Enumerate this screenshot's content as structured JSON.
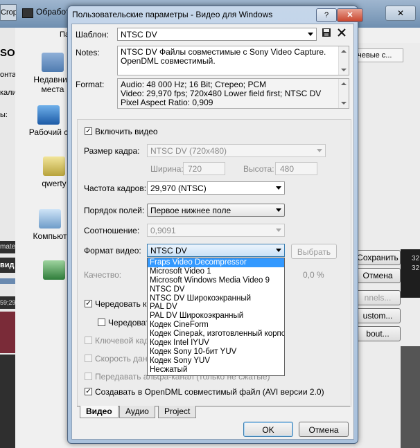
{
  "background_app": {
    "tab_fragment": "Crop",
    "title_fragment": "Обработ",
    "close_symbol": "✕",
    "left_strip": [
      "Па",
      "SOC",
      "онта",
      "кали",
      "ы:",
      "mate",
      " вид",
      "59;29"
    ],
    "right_column_header": "чевые с...",
    "right_buttons": [
      {
        "label": "Сохранить"
      },
      {
        "label": "Отмена"
      },
      {
        "label": "nnels..."
      },
      {
        "label": "ustom..."
      },
      {
        "label": "bout..."
      }
    ],
    "right_dark_text": [
      "32;",
      "32:"
    ]
  },
  "desktop_icons": [
    {
      "label": "Недавние места",
      "icon": "recent-places-icon"
    },
    {
      "label": "Рабочий с",
      "icon": "desktop-icon"
    },
    {
      "label": "qwerty",
      "icon": "user-folder-icon"
    },
    {
      "label": "Компьют",
      "icon": "computer-icon"
    },
    {
      "label": "",
      "icon": "network-icon"
    }
  ],
  "dialog": {
    "title": "Пользовательские параметры - Видео для Windows",
    "help_symbol": "?",
    "close_symbol": "✕",
    "template": {
      "label": "Шаблон:",
      "value": "NTSC DV",
      "save_icon": "save-icon",
      "delete_icon": "delete-icon"
    },
    "notes": {
      "label": "Notes:",
      "line1": "NTSC DV Файлы совместимые с Sony Video Capture.",
      "line2": "OpenDML совместимый."
    },
    "format": {
      "label": "Format:",
      "line1": "Audio: 48 000 Hz; 16 Bit; Стерео; PCM",
      "line2": "Video: 29,970 fps; 720x480 Lower field first; NTSC DV",
      "line3": "Pixel Aspect Ratio: 0,909"
    },
    "video": {
      "enable_video": {
        "label": "Включить видео",
        "checked": true
      },
      "frame_size": {
        "label": "Размер кадра:",
        "value": "NTSC DV (720x480)"
      },
      "width": {
        "label": "Ширина:",
        "value": "720"
      },
      "height": {
        "label": "Высота:",
        "value": "480"
      },
      "frame_rate": {
        "label": "Частота кадров:",
        "value": "29,970 (NTSC)"
      },
      "field_order": {
        "label": "Порядок полей:",
        "value": "Первое нижнее поле"
      },
      "aspect_ratio": {
        "label": "Соотношение:",
        "value": "0,9091"
      },
      "video_format": {
        "label": "Формат видео:",
        "value": "NTSC DV",
        "choose_button": "Выбрать"
      },
      "quality": {
        "label": "Качество:",
        "value": "0,0 %"
      },
      "interleave": {
        "label": "Чередовать ка",
        "checked": true
      },
      "interleave_sub": {
        "label": "Чередовать",
        "checked": false
      },
      "keyframe": {
        "label": "Ключевой кадр",
        "checked": false
      },
      "data_rate": {
        "label": "Скорость данн",
        "checked": false
      },
      "alpha": {
        "label": "Передавать альфа-канал (только не сжатые)",
        "checked": false
      },
      "opendml": {
        "label": "Создавать в OpenDML совместимый файл (AVI версии 2.0)",
        "checked": true
      }
    },
    "format_dropdown_options": [
      "Fraps Video Decompressor",
      "Microsoft Video 1",
      "Microsoft Windows Media Video 9",
      "NTSC DV",
      "NTSC DV Широкоэкранный",
      "PAL DV",
      "PAL DV Широкоэкранный",
      "Кодек CineForm",
      "Кодек Cinepak, изготовленный корпор",
      "Кодек Intel IYUV",
      "Кодек Sony 10-бит YUV",
      "Кодек Sony YUV",
      "Несжатый"
    ],
    "format_dropdown_selected": 0,
    "tabs": [
      "Видео",
      "Аудио",
      "Project"
    ],
    "active_tab": 0,
    "ok_label": "OK",
    "cancel_label": "Отмена"
  },
  "colors": {
    "selection": "#3399ff",
    "timeline": "#7a2b38"
  }
}
